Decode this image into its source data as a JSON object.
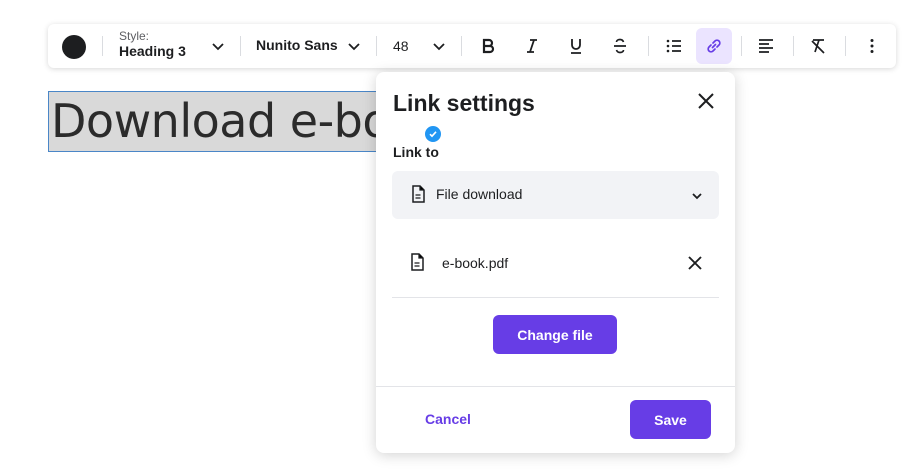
{
  "toolbar": {
    "text_color": "#1d1e20",
    "style_label": "Style:",
    "style_value": "Heading 3",
    "font_name": "Nunito Sans",
    "font_size": "48",
    "icons": [
      "chevron-down-icon",
      "bold-icon",
      "italic-icon",
      "underline-icon",
      "strikethrough-icon",
      "bulleted-list-icon",
      "link-icon",
      "align-left-icon",
      "clear-formatting-icon",
      "more-vertical-icon"
    ],
    "active_button": "link"
  },
  "editor": {
    "heading_text": "Download e-book"
  },
  "link_settings": {
    "title": "Link settings",
    "link_to_label": "Link to",
    "link_type_value": "File download",
    "file_name": "e-book.pdf",
    "change_file_label": "Change file",
    "cancel_label": "Cancel",
    "save_label": "Save"
  },
  "colors": {
    "accent": "#673de6",
    "active_bg": "#ebe4ff",
    "selection_border": "#4a86c7",
    "badge": "#2196f3"
  }
}
